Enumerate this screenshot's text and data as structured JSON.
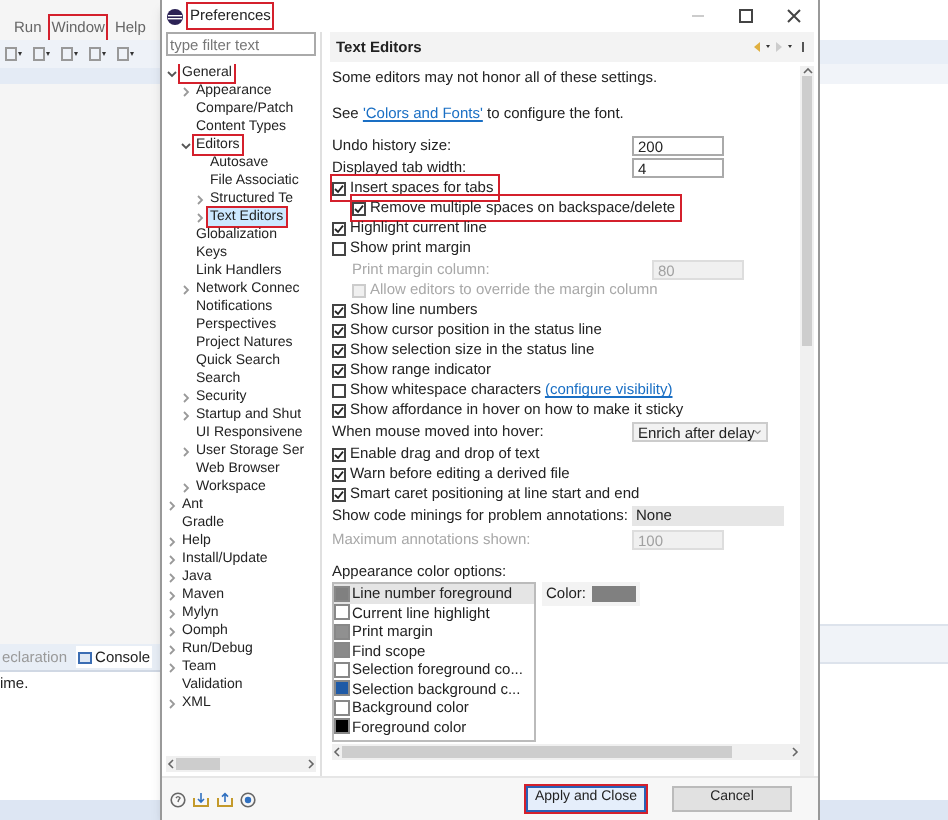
{
  "ide": {
    "menu": [
      {
        "label": "Run",
        "highlighted": false
      },
      {
        "label": "Window",
        "highlighted": true
      },
      {
        "label": "Help",
        "highlighted": false
      }
    ],
    "console_tabs": [
      {
        "label": "eclaration",
        "selected": false
      },
      {
        "label": "Console",
        "selected": true
      }
    ],
    "console_text": "ime."
  },
  "dialog": {
    "title": "Preferences",
    "title_highlighted": true,
    "filter_placeholder": "type filter text",
    "tree": [
      {
        "label": "General",
        "kind": "folder",
        "expanded": true,
        "selected": false,
        "highlighted": true,
        "children": [
          {
            "label": "Appearance",
            "kind": "folder",
            "expanded": false,
            "selected": false,
            "highlighted": false
          },
          {
            "label": "Compare/Patch",
            "kind": "leaf",
            "selected": false,
            "highlighted": false
          },
          {
            "label": "Content Types",
            "kind": "leaf",
            "selected": false,
            "highlighted": false
          },
          {
            "label": "Editors",
            "kind": "folder",
            "expanded": true,
            "selected": false,
            "highlighted": true,
            "children": [
              {
                "label": "Autosave",
                "kind": "leaf",
                "selected": false,
                "highlighted": false
              },
              {
                "label": "File Associatic",
                "kind": "leaf",
                "selected": false,
                "highlighted": false
              },
              {
                "label": "Structured Te",
                "kind": "folder",
                "expanded": false,
                "selected": false,
                "highlighted": false
              },
              {
                "label": "Text Editors",
                "kind": "folder",
                "expanded": false,
                "selected": true,
                "highlighted": true
              }
            ]
          },
          {
            "label": "Globalization",
            "kind": "leaf",
            "selected": false,
            "highlighted": false
          },
          {
            "label": "Keys",
            "kind": "leaf",
            "selected": false,
            "highlighted": false
          },
          {
            "label": "Link Handlers",
            "kind": "leaf",
            "selected": false,
            "highlighted": false
          },
          {
            "label": "Network Connec",
            "kind": "folder",
            "expanded": false,
            "selected": false,
            "highlighted": false
          },
          {
            "label": "Notifications",
            "kind": "leaf",
            "selected": false,
            "highlighted": false
          },
          {
            "label": "Perspectives",
            "kind": "leaf",
            "selected": false,
            "highlighted": false
          },
          {
            "label": "Project Natures",
            "kind": "leaf",
            "selected": false,
            "highlighted": false
          },
          {
            "label": "Quick Search",
            "kind": "leaf",
            "selected": false,
            "highlighted": false
          },
          {
            "label": "Search",
            "kind": "leaf",
            "selected": false,
            "highlighted": false
          },
          {
            "label": "Security",
            "kind": "folder",
            "expanded": false,
            "selected": false,
            "highlighted": false
          },
          {
            "label": "Startup and Shut",
            "kind": "folder",
            "expanded": false,
            "selected": false,
            "highlighted": false
          },
          {
            "label": "UI Responsivene",
            "kind": "leaf",
            "selected": false,
            "highlighted": false
          },
          {
            "label": "User Storage Ser",
            "kind": "folder",
            "expanded": false,
            "selected": false,
            "highlighted": false
          },
          {
            "label": "Web Browser",
            "kind": "leaf",
            "selected": false,
            "highlighted": false
          },
          {
            "label": "Workspace",
            "kind": "folder",
            "expanded": false,
            "selected": false,
            "highlighted": false
          }
        ]
      },
      {
        "label": "Ant",
        "kind": "folder",
        "expanded": false,
        "selected": false,
        "highlighted": false
      },
      {
        "label": "Gradle",
        "kind": "leaf",
        "selected": false,
        "highlighted": false
      },
      {
        "label": "Help",
        "kind": "folder",
        "expanded": false,
        "selected": false,
        "highlighted": false
      },
      {
        "label": "Install/Update",
        "kind": "folder",
        "expanded": false,
        "selected": false,
        "highlighted": false
      },
      {
        "label": "Java",
        "kind": "folder",
        "expanded": false,
        "selected": false,
        "highlighted": false
      },
      {
        "label": "Maven",
        "kind": "folder",
        "expanded": false,
        "selected": false,
        "highlighted": false
      },
      {
        "label": "Mylyn",
        "kind": "folder",
        "expanded": false,
        "selected": false,
        "highlighted": false
      },
      {
        "label": "Oomph",
        "kind": "folder",
        "expanded": false,
        "selected": false,
        "highlighted": false
      },
      {
        "label": "Run/Debug",
        "kind": "folder",
        "expanded": false,
        "selected": false,
        "highlighted": false
      },
      {
        "label": "Team",
        "kind": "folder",
        "expanded": false,
        "selected": false,
        "highlighted": false
      },
      {
        "label": "Validation",
        "kind": "leaf",
        "selected": false,
        "highlighted": false
      },
      {
        "label": "XML",
        "kind": "folder",
        "expanded": false,
        "selected": false,
        "highlighted": false
      }
    ],
    "page_title": "Text Editors",
    "settings": [
      {
        "kind": "text",
        "label": "Some editors may not honor all of these settings."
      },
      {
        "kind": "link_text",
        "before": "See ",
        "link": "'Colors and Fonts'",
        "after": " to configure the font."
      },
      {
        "kind": "field",
        "label": "Undo history size:",
        "value": "200",
        "disabled": false
      },
      {
        "kind": "field",
        "label": "Displayed tab width:",
        "value": "4",
        "disabled": false
      },
      {
        "kind": "checkbox",
        "label": "Insert spaces for tabs",
        "checked": true,
        "disabled": false,
        "highlighted": true,
        "children": [
          {
            "kind": "checkbox",
            "label": "Remove multiple spaces on backspace/delete",
            "checked": true,
            "disabled": false,
            "highlighted": true
          }
        ]
      },
      {
        "kind": "checkbox",
        "label": "Highlight current line",
        "checked": true,
        "disabled": false,
        "highlighted": false
      },
      {
        "kind": "checkbox",
        "label": "Show print margin",
        "checked": false,
        "disabled": false,
        "highlighted": false,
        "children": [
          {
            "kind": "field",
            "label": "Print margin column:",
            "value": "80",
            "disabled": true
          },
          {
            "kind": "checkbox",
            "label": "Allow editors to override the margin column",
            "checked": false,
            "disabled": true,
            "highlighted": false
          }
        ]
      },
      {
        "kind": "checkbox",
        "label": "Show line numbers",
        "checked": true,
        "disabled": false,
        "highlighted": false
      },
      {
        "kind": "checkbox",
        "label": "Show cursor position in the status line",
        "checked": true,
        "disabled": false,
        "highlighted": false
      },
      {
        "kind": "checkbox",
        "label": "Show selection size in the status line",
        "checked": true,
        "disabled": false,
        "highlighted": false
      },
      {
        "kind": "checkbox",
        "label": "Show range indicator",
        "checked": true,
        "disabled": false,
        "highlighted": false
      },
      {
        "kind": "checkbox",
        "label": "Show whitespace characters",
        "link": "(configure visibility)",
        "checked": false,
        "disabled": false,
        "highlighted": false
      },
      {
        "kind": "checkbox",
        "label": "Show affordance in hover on how to make it sticky",
        "checked": true,
        "disabled": false,
        "highlighted": false
      },
      {
        "kind": "dropdown",
        "label": "When mouse moved into hover:",
        "value": "Enrich after delay"
      },
      {
        "kind": "checkbox",
        "label": "Enable drag and drop of text",
        "checked": true,
        "disabled": false,
        "highlighted": false
      },
      {
        "kind": "checkbox",
        "label": "Warn before editing a derived file",
        "checked": true,
        "disabled": false,
        "highlighted": false
      },
      {
        "kind": "checkbox",
        "label": "Smart caret positioning at line start and end",
        "checked": true,
        "disabled": false,
        "highlighted": false
      },
      {
        "kind": "combo",
        "label": "Show code minings for problem annotations:",
        "value": "None"
      },
      {
        "kind": "field",
        "label": "Maximum annotations shown:",
        "value": "100",
        "disabled": true
      }
    ],
    "appearance": {
      "label": "Appearance color options:",
      "color_label": "Color:",
      "color": "#808080",
      "items": [
        {
          "label": "Line number foreground",
          "color": "#808080",
          "selected": true
        },
        {
          "label": "Current line highlight",
          "color": "#ffffff",
          "selected": false
        },
        {
          "label": "Print margin",
          "color": "#909090",
          "selected": false
        },
        {
          "label": "Find scope",
          "color": "#8a8a8a",
          "selected": false
        },
        {
          "label": "Selection foreground co...",
          "color": "#ffffff",
          "selected": false
        },
        {
          "label": "Selection background c...",
          "color": "#1f5aa6",
          "selected": false
        },
        {
          "label": "Background color",
          "color": "#ffffff",
          "selected": false
        },
        {
          "label": "Foreground color",
          "color": "#000000",
          "selected": false
        }
      ]
    },
    "buttons": [
      {
        "label": "Apply and Close",
        "primary": true,
        "highlighted": true
      },
      {
        "label": "Cancel",
        "primary": false,
        "highlighted": false
      }
    ]
  }
}
